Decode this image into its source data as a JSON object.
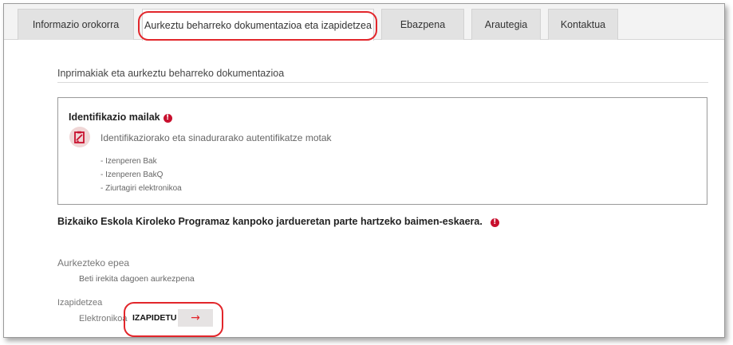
{
  "tabs": [
    {
      "label": "Informazio orokorra",
      "active": false
    },
    {
      "label": "Aurkeztu beharreko dokumentazioa eta izapidetzea",
      "active": true
    },
    {
      "label": "Ebazpena",
      "active": false
    },
    {
      "label": "Arautegia",
      "active": false
    },
    {
      "label": "Kontaktua",
      "active": false
    }
  ],
  "section": {
    "title": "Inprimakiak eta aurkeztu beharreko dokumentazioa"
  },
  "identification": {
    "title": "Identifikazio mailak",
    "alert_glyph": "!",
    "description": "Identifikaziorako eta sinadurarako autentifikatze motak",
    "items": [
      "- Izenperen Bak",
      "- Izenperen BakQ",
      "- Ziurtagiri elektronikoa"
    ]
  },
  "procedure": {
    "title": "Bizkaiko Eskola Kiroleko Programaz kanpoko jardueretan parte hartzeko baimen-eskaera.",
    "alert_glyph": "!"
  },
  "deadline": {
    "label": "Aurkezteko epea",
    "value": "Beti irekita dagoen aurkezpena"
  },
  "tramitation": {
    "label": "Izapidetzea",
    "channel": "Elektronikoa",
    "button_label": "IZAPIDETU",
    "button_arrow": "→"
  },
  "colors": {
    "accent": "#e2262b",
    "alert": "#c8102e",
    "tab_bg": "#e2e2e2"
  },
  "icons": {
    "identification": "signed-document-icon"
  }
}
